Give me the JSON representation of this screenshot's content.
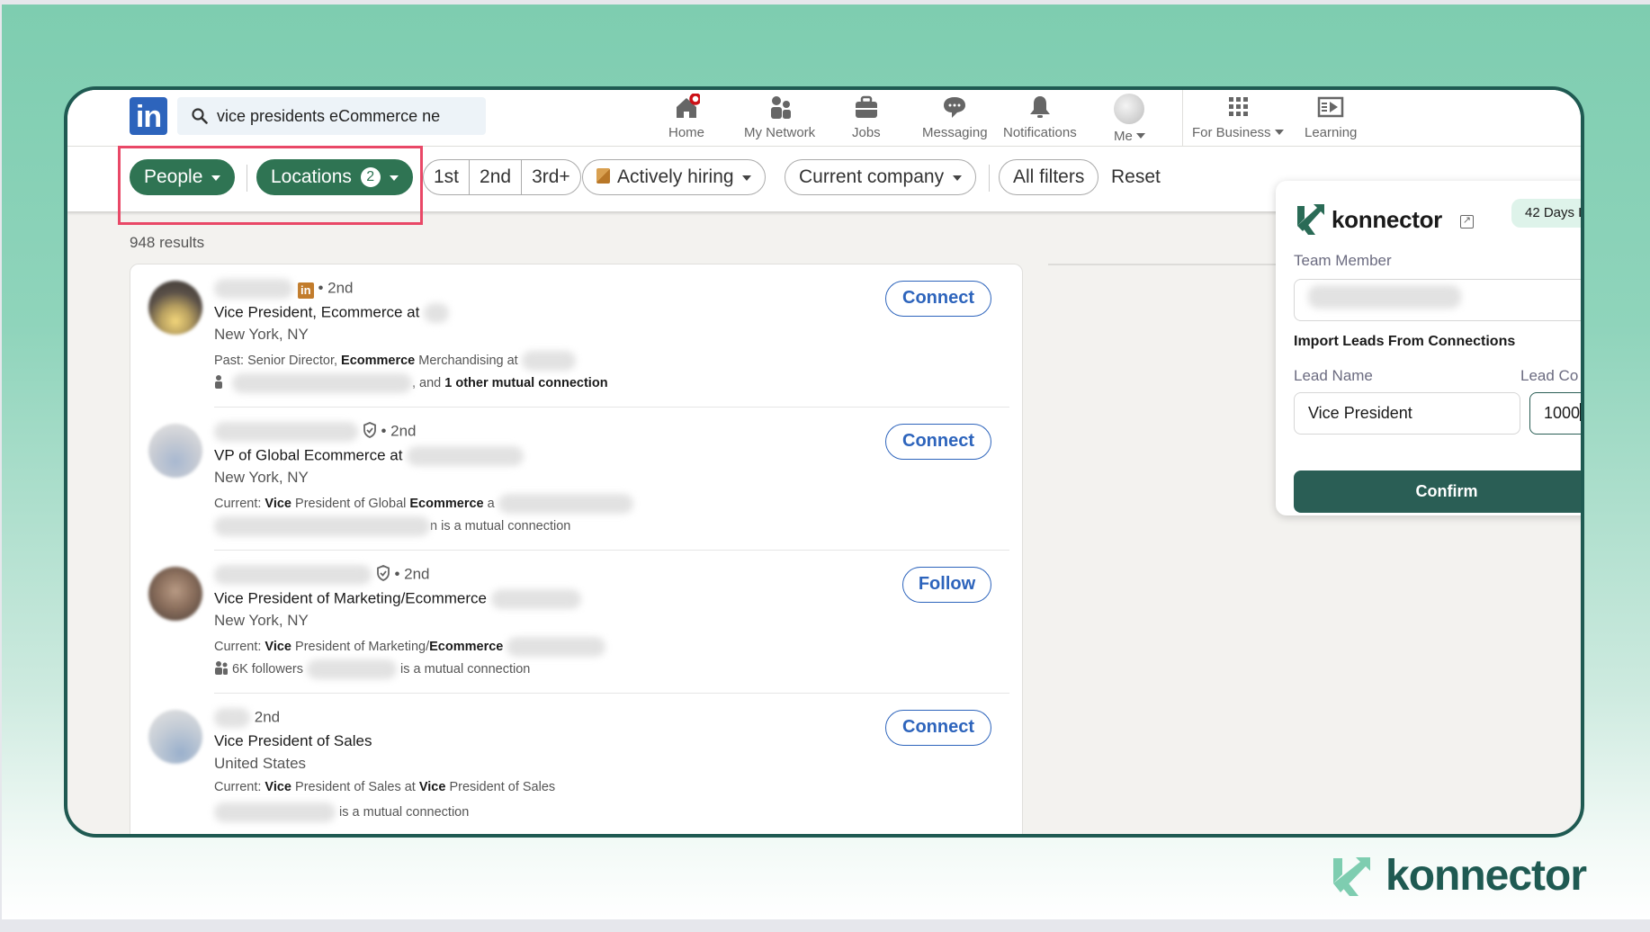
{
  "linkedin": {
    "search_query": "vice presidents eCommerce ne",
    "nav": [
      {
        "label": "Home",
        "icon": "home-icon"
      },
      {
        "label": "My Network",
        "icon": "network-icon"
      },
      {
        "label": "Jobs",
        "icon": "briefcase-icon"
      },
      {
        "label": "Messaging",
        "icon": "chat-icon"
      },
      {
        "label": "Notifications",
        "icon": "bell-icon"
      },
      {
        "label": "Me",
        "icon": "avatar"
      },
      {
        "label": "For Business",
        "icon": "grid-icon"
      },
      {
        "label": "Learning",
        "icon": "play-icon"
      }
    ],
    "filters": {
      "people": "People",
      "locations": "Locations",
      "locations_count": "2",
      "degrees": [
        "1st",
        "2nd",
        "3rd+"
      ],
      "actively_hiring": "Actively hiring",
      "current_company": "Current company",
      "all_filters": "All filters",
      "reset": "Reset"
    },
    "results_count": "948 results",
    "results": [
      {
        "degree": "• 2nd",
        "headline": "Vice President, Ecommerce at",
        "location": "New York, NY",
        "detail_prefix": "Past: Senior Director, ",
        "detail_bold": "Ecommerce",
        "detail_suffix": " Merchandising at",
        "mutual_text": ", and ",
        "mutual_bold": "1 other mutual connection",
        "action": "Connect"
      },
      {
        "degree": "• 2nd",
        "headline": "VP of Global Ecommerce at",
        "location": "New York, NY",
        "detail_label": "Current: ",
        "detail_bold1": "Vice",
        "detail_mid": " President of Global ",
        "detail_bold2": "Ecommerce",
        "detail_suffix": " a",
        "mutual_text": "n is a mutual connection",
        "action": "Connect"
      },
      {
        "degree": "• 2nd",
        "headline": "Vice President of Marketing/Ecommerce",
        "location": "New York, NY",
        "detail_label": "Current: ",
        "detail_bold1": "Vice",
        "detail_mid": " President of Marketing/",
        "detail_bold2": "Ecommerce",
        "followers": "6K followers",
        "mutual_text": "is a mutual connection",
        "action": "Follow"
      },
      {
        "degree": "2nd",
        "headline": "Vice President of Sales",
        "location": "United States",
        "detail_label": "Current: ",
        "detail_bold1": "Vice",
        "detail_mid": " President of Sales at ",
        "detail_bold2": "Vice",
        "detail_suffix": " President of Sales",
        "mutual_text": "is a mutual connection",
        "action": "Connect"
      }
    ]
  },
  "konnector": {
    "brand": "konnector",
    "days_badge": "42 Days L",
    "team_member_label": "Team Member",
    "section_title": "Import Leads From Connections",
    "lead_name_label": "Lead Name",
    "lead_name_value": "Vice President",
    "lead_count_label": "Lead Co",
    "lead_count_value": "1000",
    "confirm_label": "Confirm",
    "accent": "#2a5e55",
    "badge_bg": "#def3ea"
  },
  "footer_brand": "konnector",
  "colors": {
    "linkedin_blue": "#2d64bc",
    "filter_green": "#2f7453",
    "highlight_red": "#e94867",
    "frame": "#1f5a52"
  }
}
